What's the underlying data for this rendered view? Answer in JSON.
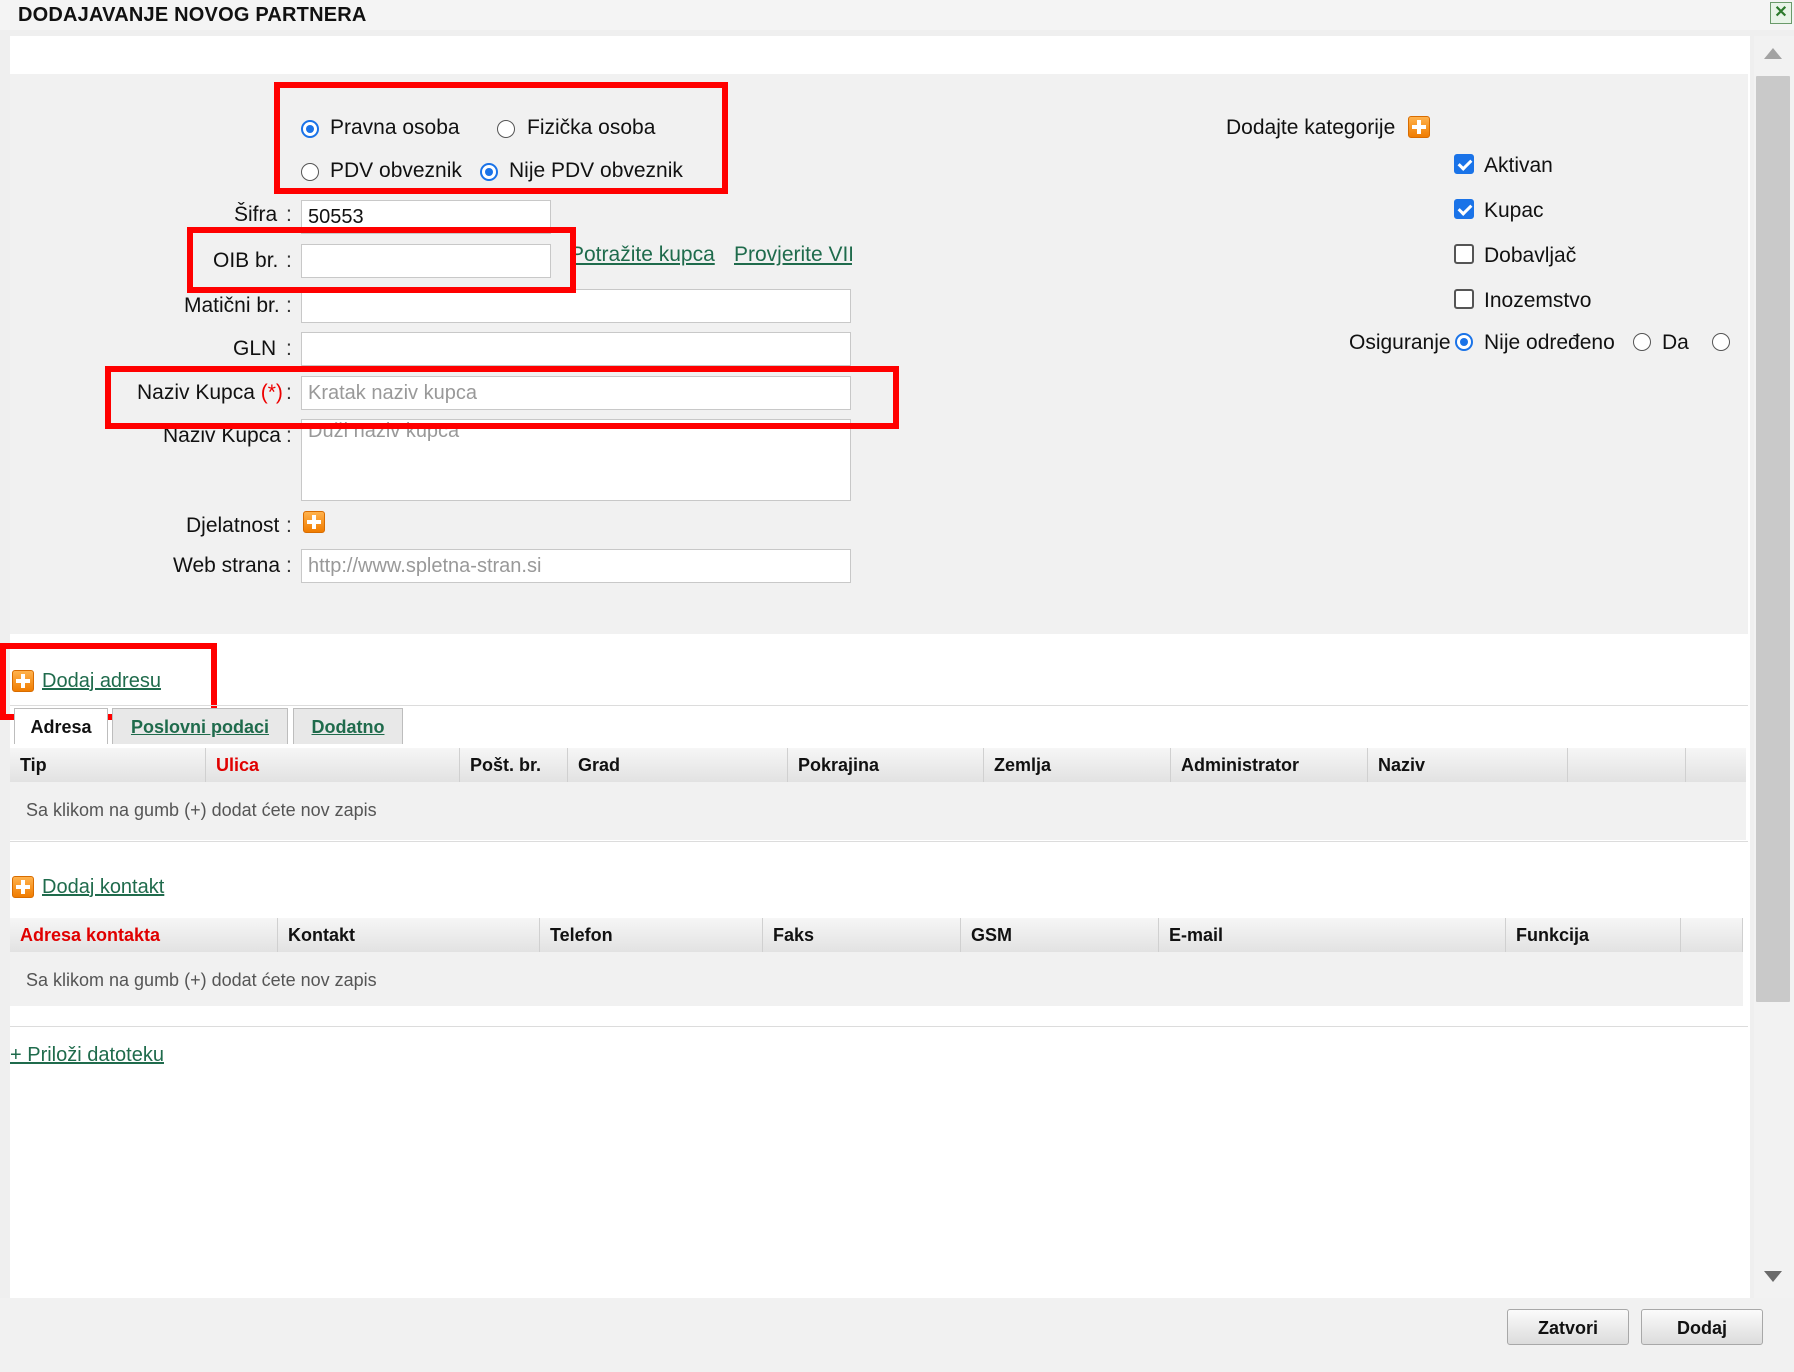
{
  "dialog": {
    "title": "DODAJAVANJE NOVOG PARTNERA"
  },
  "entity_type": {
    "options": [
      {
        "label": "Pravna osoba",
        "selected": true
      },
      {
        "label": "Fizička osoba",
        "selected": false
      }
    ]
  },
  "vat": {
    "options": [
      {
        "label": "PDV obveznik",
        "selected": false
      },
      {
        "label": "Nije PDV obveznik",
        "selected": true
      }
    ]
  },
  "form": {
    "sifra": {
      "label": "Šifra",
      "value": "50553"
    },
    "oib": {
      "label": "OIB br.",
      "value": ""
    },
    "lookup_link": "Potražite kupca",
    "vies_link": "Provjerite VIE",
    "maticni": {
      "label": "Matični br.",
      "value": ""
    },
    "gln": {
      "label": "GLN",
      "value": ""
    },
    "naziv_kratki": {
      "label": "Naziv Kupca",
      "required_mark": "(*)",
      "placeholder": "Kratak naziv kupca"
    },
    "naziv_dugi": {
      "label": "Naziv Kupca",
      "placeholder": "Duži naziv kupca"
    },
    "djelatnost": {
      "label": "Djelatnost"
    },
    "web": {
      "label": "Web strana",
      "placeholder": "http://www.spletna-stran.si"
    },
    "colon": ":"
  },
  "categories": {
    "title": "Dodajte kategorije",
    "items": [
      {
        "label": "Aktivan",
        "checked": true
      },
      {
        "label": "Kupac",
        "checked": true
      },
      {
        "label": "Dobavljač",
        "checked": false
      },
      {
        "label": "Inozemstvo",
        "checked": false
      }
    ]
  },
  "insurance": {
    "label": "Osiguranje",
    "options": [
      {
        "label": "Nije određeno",
        "selected": true
      },
      {
        "label": "Da",
        "selected": false
      },
      {
        "label": "",
        "selected": false
      }
    ]
  },
  "address": {
    "add_link": "Dodaj adresu",
    "tabs": [
      "Adresa",
      "Poslovni podaci",
      "Dodatno"
    ],
    "columns": [
      "Tip",
      "Ulica",
      "Pošt. br.",
      "Grad",
      "Pokrajina",
      "Zemlja",
      "Administrator",
      "Naziv"
    ],
    "empty_text": "Sa klikom na gumb (+) dodat ćete nov zapis"
  },
  "contacts": {
    "add_link": "Dodaj kontakt",
    "columns": [
      "Adresa kontakta",
      "Kontakt",
      "Telefon",
      "Faks",
      "GSM",
      "E-mail",
      "Funkcija"
    ],
    "empty_text": "Sa klikom na gumb (+) dodat ćete nov zapis"
  },
  "attach_link": "+ Priloži datoteku",
  "buttons": {
    "close": "Zatvori",
    "add": "Dodaj"
  },
  "colors": {
    "accent": "#1a73e8",
    "link": "#1f6b4c",
    "highlight": "#ff0000",
    "add_icon": "#f58a07"
  }
}
